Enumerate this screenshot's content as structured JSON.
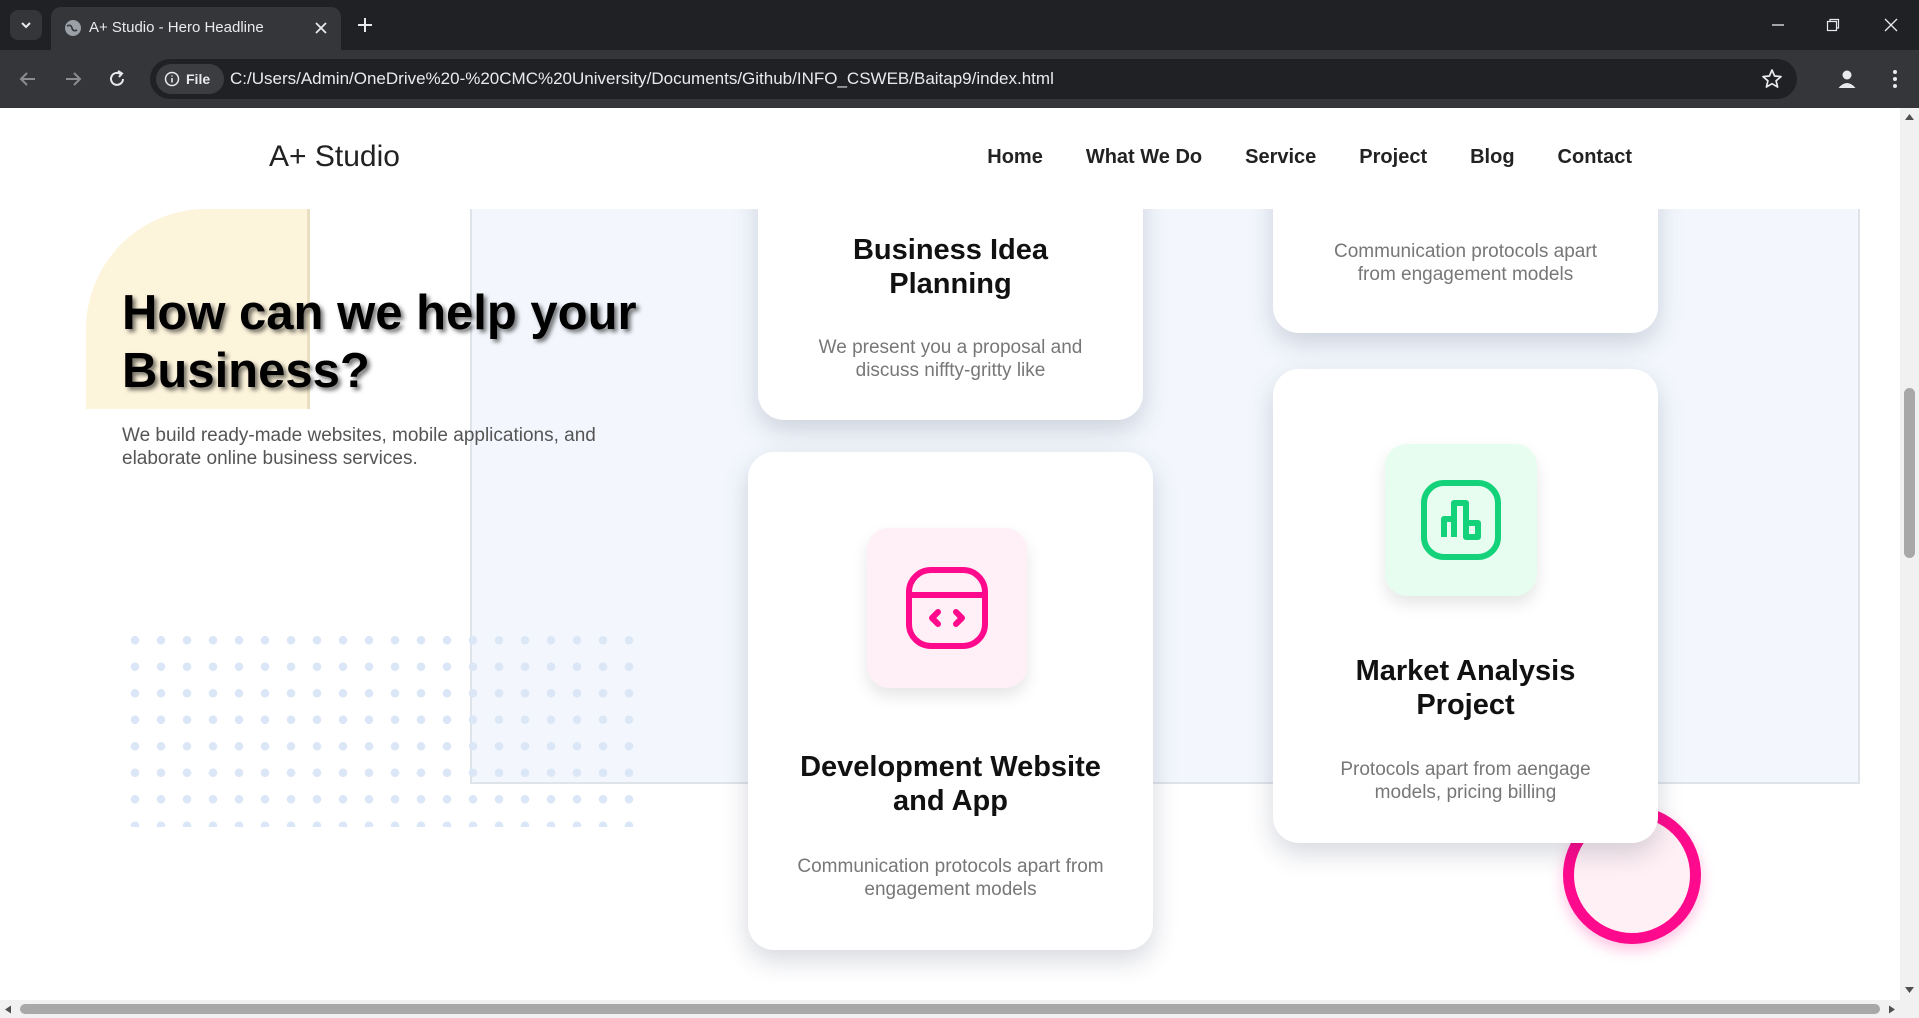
{
  "browser": {
    "tab_title": "A+ Studio - Hero Headline",
    "chip_label": "File",
    "url": "C:/Users/Admin/OneDrive%20-%20CMC%20University/Documents/Github/INFO_CSWEB/Baitap9/index.html"
  },
  "site": {
    "logo": "A+ Studio",
    "nav": [
      "Home",
      "What We Do",
      "Service",
      "Project",
      "Blog",
      "Contact"
    ]
  },
  "hero": {
    "title": "How can we help your Business?",
    "subtitle": "We build ready-made websites, mobile applications, and elaborate online business services."
  },
  "cards": {
    "business": {
      "title": "Business Idea Planning",
      "text": "We present you a proposal and discuss niffty-gritty like"
    },
    "top_right": {
      "text": "Communication protocols apart from engagement models"
    },
    "development": {
      "title": "Development Website and App",
      "text": "Communication protocols apart from engagement models",
      "icon": "code-window-icon"
    },
    "market": {
      "title": "Market Analysis Project",
      "text": "Protocols apart from aengage models, pricing billing",
      "icon": "chart-icon"
    }
  },
  "colors": {
    "accent_pink": "#ff0a8d",
    "accent_green": "#14d27a",
    "panel_blue": "#f3f7fd",
    "shape_yellow": "#fdf4dc"
  }
}
